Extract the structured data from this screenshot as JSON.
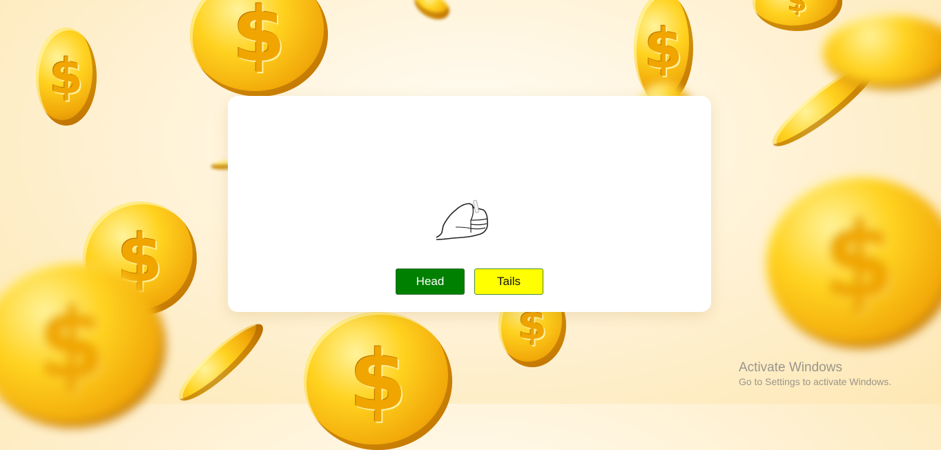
{
  "buttons": {
    "head_label": "Head",
    "tails_label": "Tails"
  },
  "illustration": {
    "icon": "hand-flipping-coin-icon"
  },
  "background": {
    "icon": "gold-dollar-coin-icon",
    "coin_symbol": "$"
  },
  "watermark": {
    "title": "Activate Windows",
    "subtitle": "Go to Settings to activate Windows."
  },
  "colors": {
    "head_button": "#008000",
    "tails_button": "#ffff00",
    "coin_gold": "#ffd21f",
    "card": "#ffffff"
  }
}
